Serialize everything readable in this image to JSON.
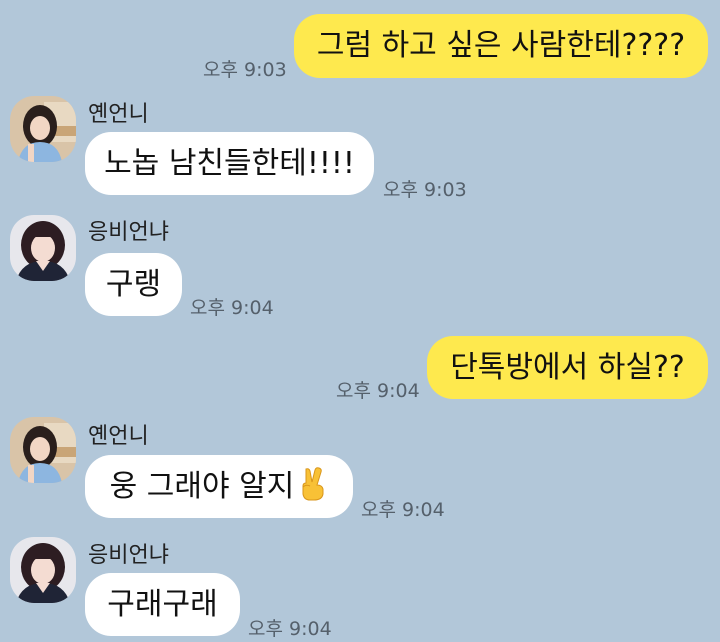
{
  "messages": [
    {
      "type": "sent",
      "text": "그럼 하고 싶은 사람한테????",
      "time": "오후 9:03"
    },
    {
      "type": "received",
      "sender": "옌언니",
      "text": "노놉 남친들한테!!!!",
      "time": "오후 9:03"
    },
    {
      "type": "received",
      "sender": "응비언냐",
      "text": "구랭",
      "time": "오후 9:04"
    },
    {
      "type": "sent",
      "text": "단톡방에서 하실??",
      "time": "오후 9:04"
    },
    {
      "type": "received",
      "sender": "옌언니",
      "text": "웅 그래야 알지",
      "emoji": "victory-hand",
      "time": "오후 9:04"
    },
    {
      "type": "received",
      "sender": "응비언냐",
      "text": "구래구래",
      "time": "오후 9:04"
    }
  ],
  "colors": {
    "background": "#b2c7d9",
    "sent_bubble": "#fee94e",
    "received_bubble": "#ffffff",
    "timestamp": "#55606b"
  }
}
